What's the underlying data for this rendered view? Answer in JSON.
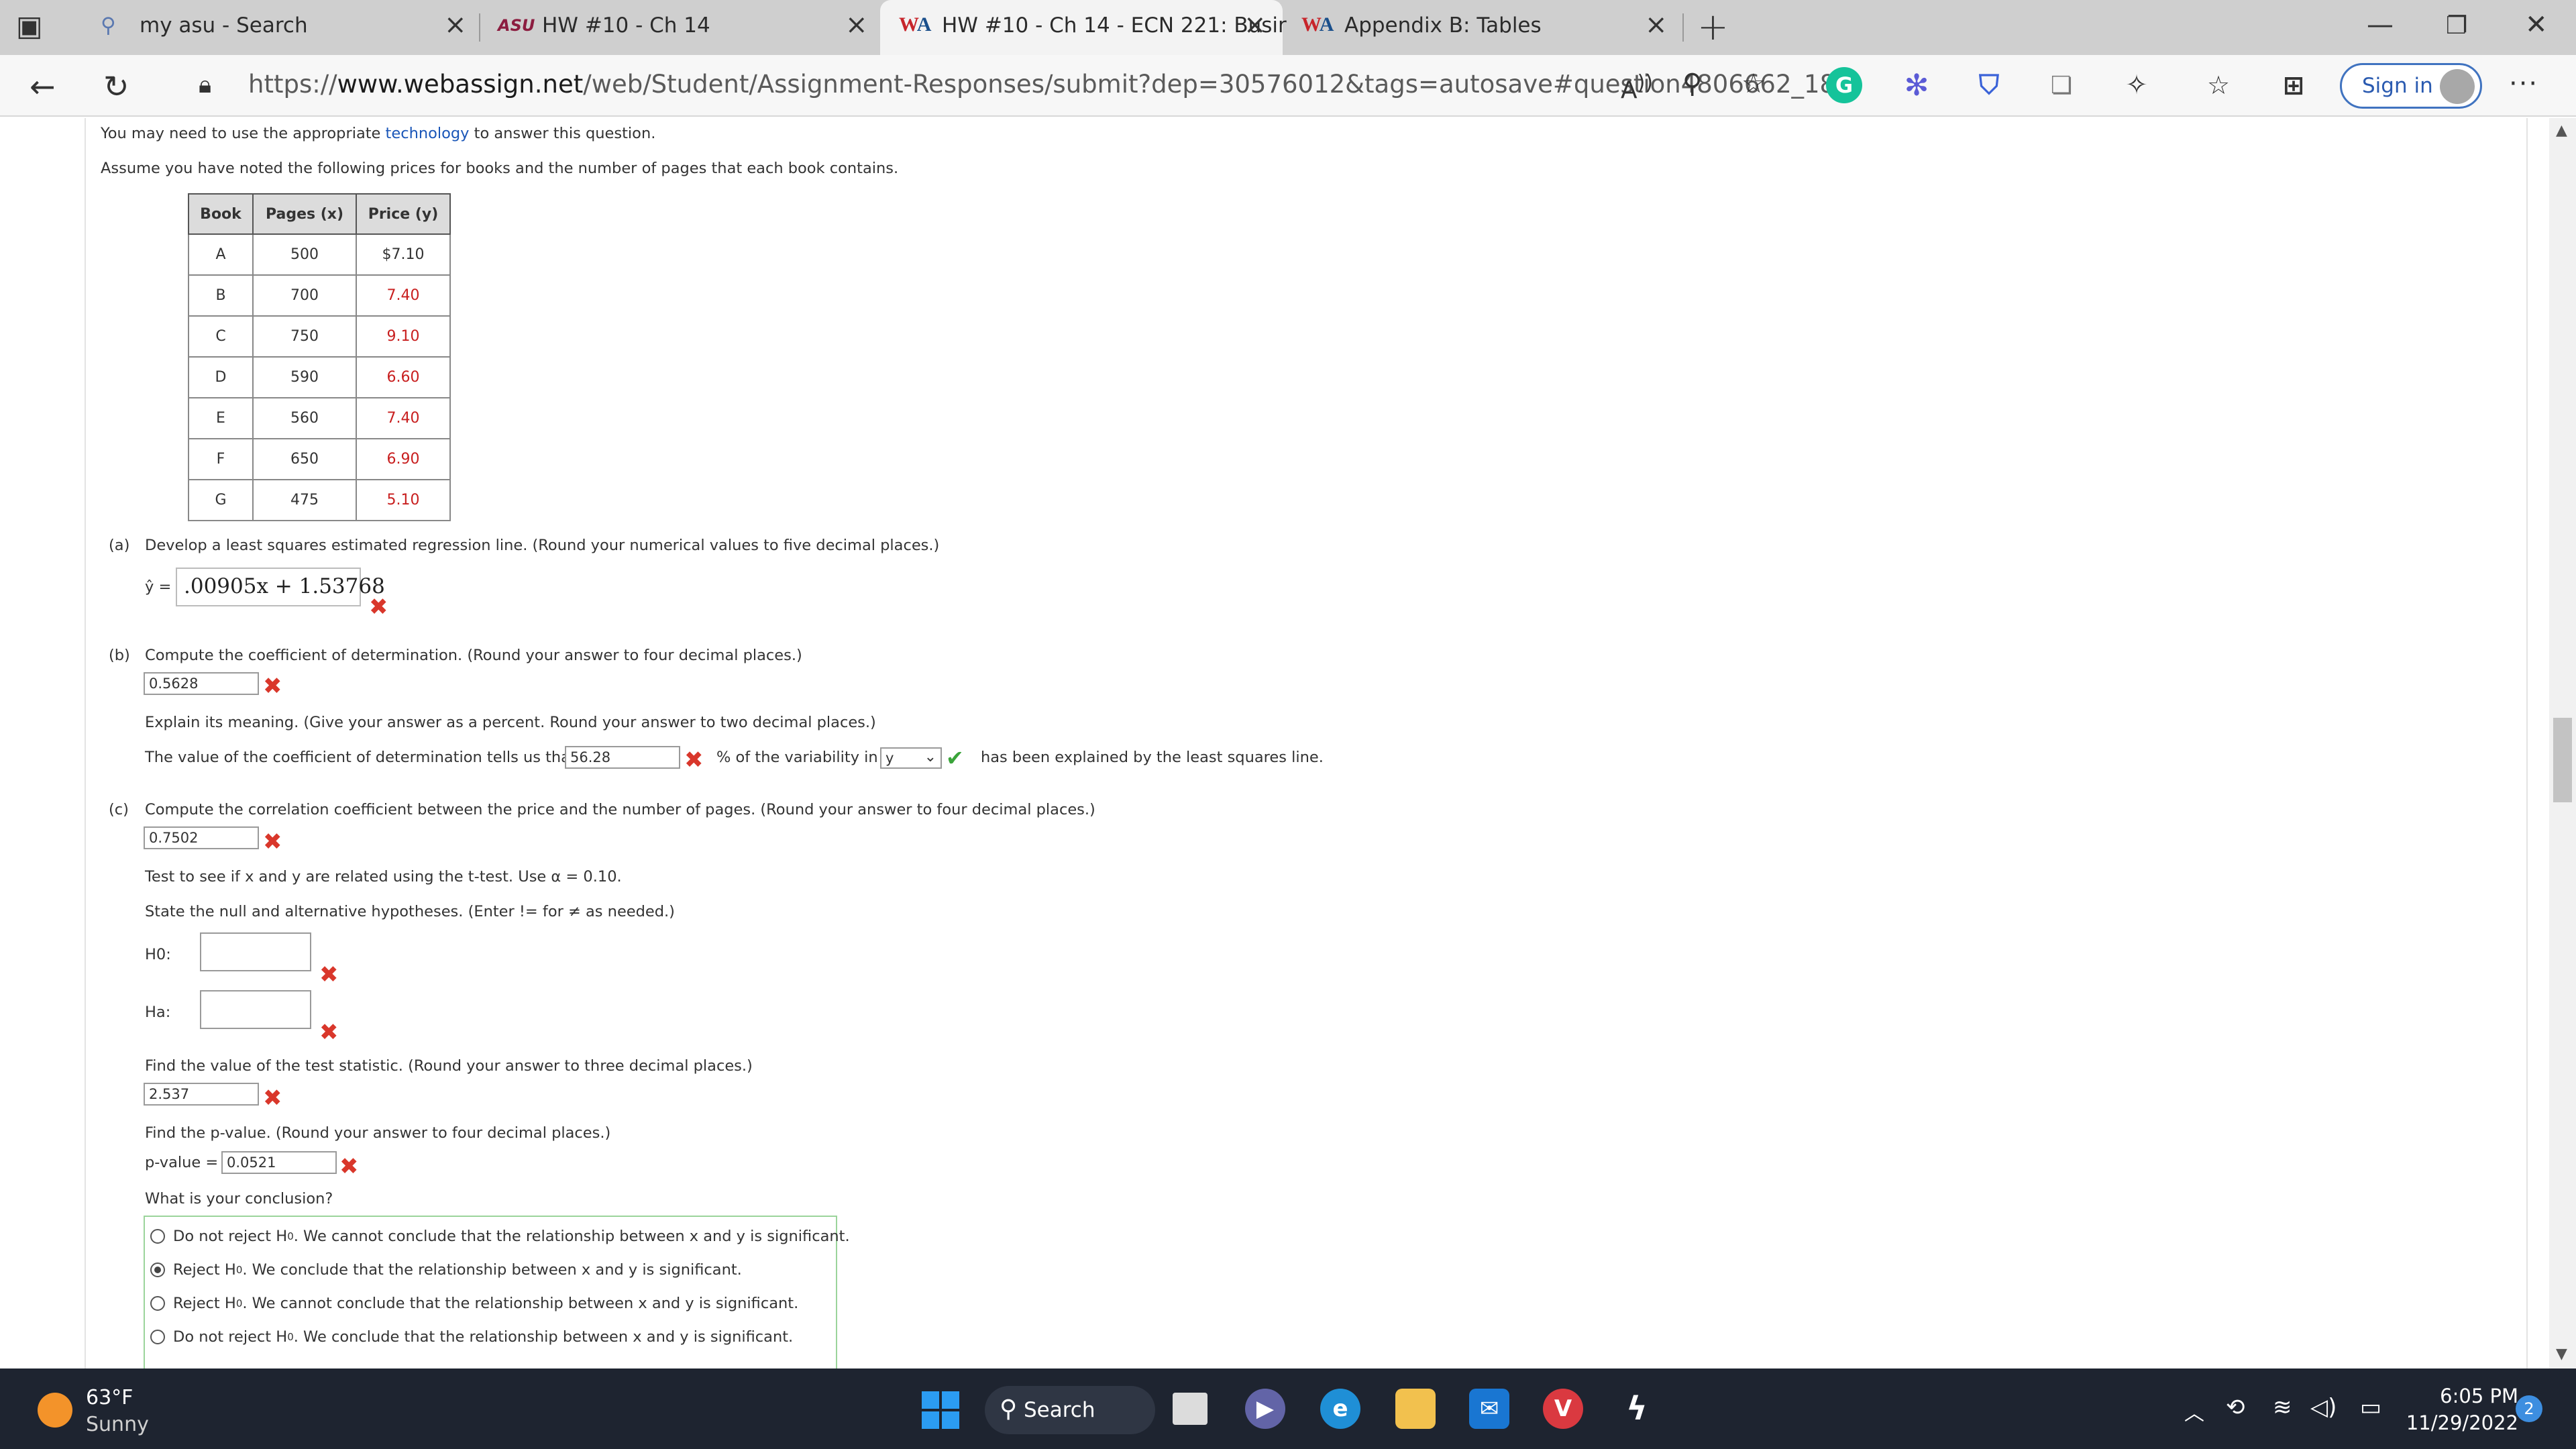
{
  "browser": {
    "tabs": [
      {
        "title": "my asu - Search",
        "favicon": "search-icon"
      },
      {
        "title": "HW #10 - Ch 14",
        "favicon": "asu-logo"
      },
      {
        "title": "HW #10 - Ch 14 - ECN 221: Busir",
        "favicon": "webassign-logo",
        "active": true
      },
      {
        "title": "Appendix B: Tables",
        "favicon": "webassign-logo"
      }
    ],
    "address": {
      "scheme": "https://",
      "host": "www.webassign.net",
      "path": "/web/Student/Assignment-Responses/submit?dep=30576012&tags=autosave#question4806662_18"
    },
    "sign_in_label": "Sign in"
  },
  "question": {
    "intro_before": "You may need to use the appropriate ",
    "intro_link": "technology",
    "intro_after": " to answer this question.",
    "premise": "Assume you have noted the following prices for books and the number of pages that each book contains.",
    "table": {
      "headers": [
        "Book",
        "Pages (x)",
        "Price (y)"
      ],
      "rows": [
        [
          "A",
          "500",
          "$7.10"
        ],
        [
          "B",
          "700",
          "7.40"
        ],
        [
          "C",
          "750",
          "9.10"
        ],
        [
          "D",
          "590",
          "6.60"
        ],
        [
          "E",
          "560",
          "7.40"
        ],
        [
          "F",
          "650",
          "6.90"
        ],
        [
          "G",
          "475",
          "5.10"
        ]
      ]
    },
    "part_a": {
      "label": "(a)",
      "prompt": "Develop a least squares estimated regression line. (Round your numerical values to five decimal places.)",
      "yhat_label": "ŷ =",
      "answer": ".00905x + 1.53768"
    },
    "part_b": {
      "label": "(b)",
      "prompt": "Compute the coefficient of determination. (Round your answer to four decimal places.)",
      "answer": "0.5628",
      "explain_prompt": "Explain its meaning. (Give your answer as a percent. Round your answer to two decimal places.)",
      "sentence_before": "The value of the coefficient of determination tells us that",
      "percent_answer": "56.28",
      "sentence_mid": "% of the variability in",
      "select_value": "y",
      "sentence_after": "has been explained by the least squares line."
    },
    "part_c": {
      "label": "(c)",
      "prompt": "Compute the correlation coefficient between the price and the number of pages. (Round your answer to four decimal places.)",
      "answer": "0.7502",
      "test_prompt": "Test to see if x and y are related using the t-test. Use α = 0.10.",
      "hypotheses_prompt": "State the null and alternative hypotheses. (Enter != for ≠ as needed.)",
      "h0_label": "H0:",
      "ha_label": "Ha:",
      "stat_prompt": "Find the value of the test statistic. (Round your answer to three decimal places.)",
      "stat_answer": "2.537",
      "p_prompt": "Find the p-value. (Round your answer to four decimal places.)",
      "p_label": "p-value =",
      "p_answer": "0.0521",
      "conclusion_prompt": "What is your conclusion?",
      "options": [
        {
          "lead": "Do not reject H",
          "tail": ". We cannot conclude that the relationship between x and y is significant.",
          "selected": false
        },
        {
          "lead": "Reject H",
          "tail": ". We conclude that the relationship between x and y is significant.",
          "selected": true
        },
        {
          "lead": "Reject H",
          "tail": ". We cannot conclude that the relationship between x and y is significant.",
          "selected": false
        },
        {
          "lead": "Do not reject H",
          "tail": ". We conclude that the relationship between x and y is significant.",
          "selected": false
        }
      ]
    }
  },
  "taskbar": {
    "weather_temp": "63°F",
    "weather_condition": "Sunny",
    "search_label": "Search",
    "time": "6:05 PM",
    "date": "11/29/2022",
    "notification_count": "2"
  },
  "colors": {
    "incorrect": "#d9372b",
    "correct": "#3aa43a",
    "link": "#1a56b8",
    "accent": "#4073c0"
  }
}
